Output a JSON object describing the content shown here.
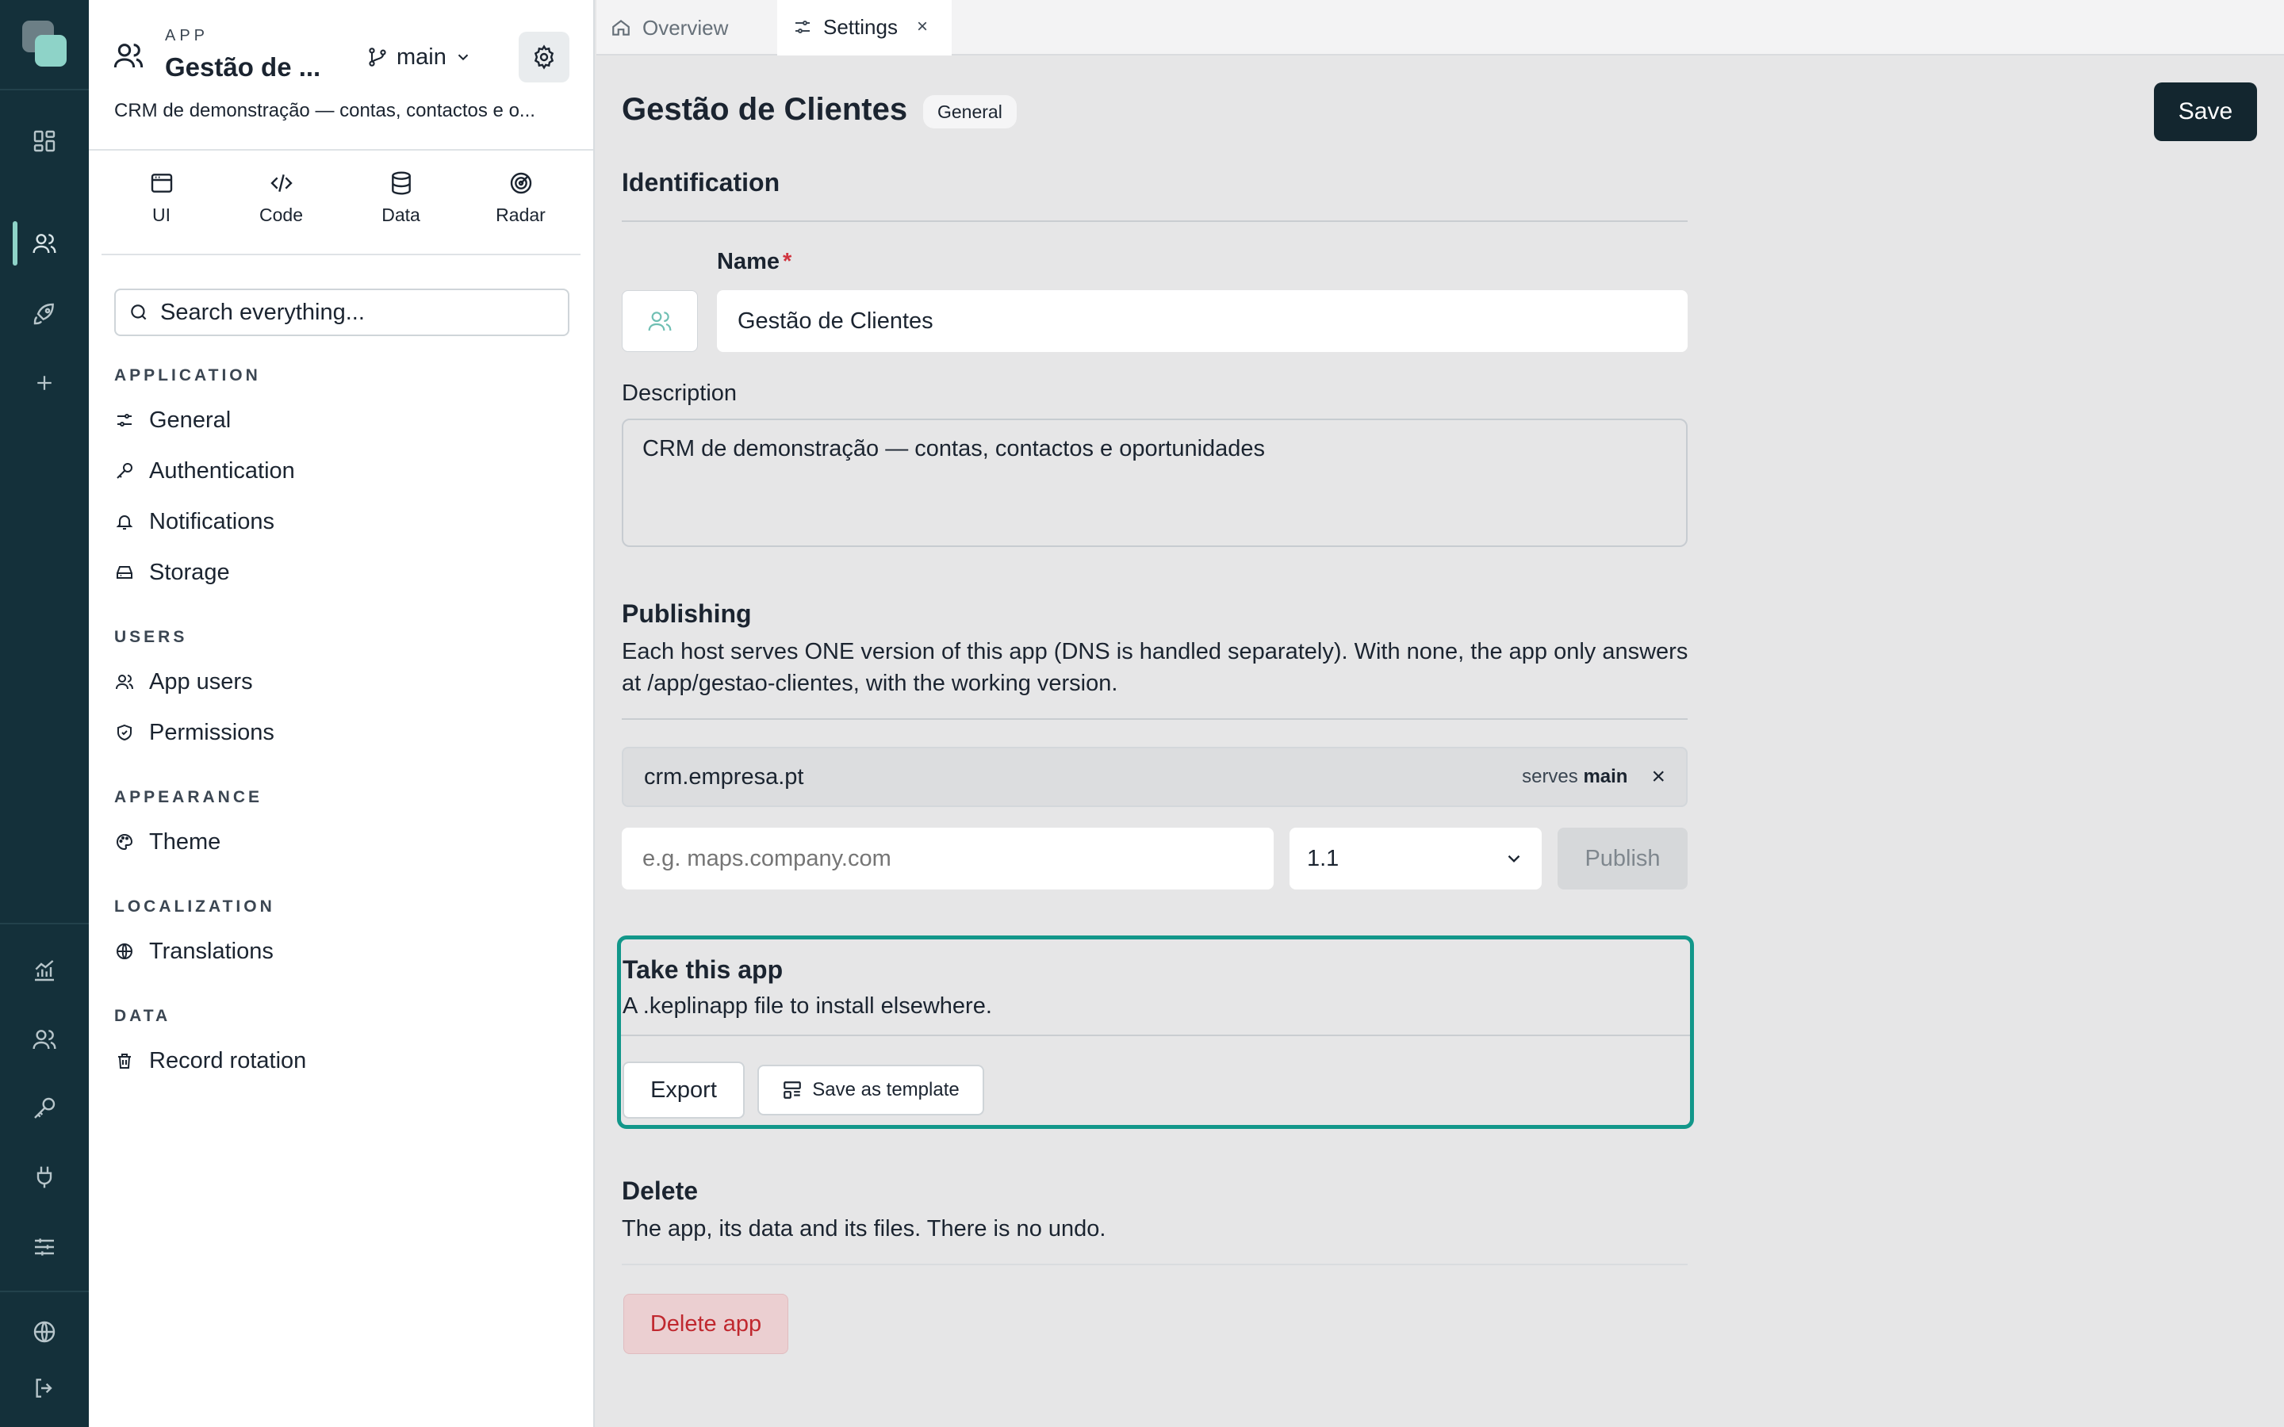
{
  "sidebar": {
    "app_kicker": "APP",
    "app_title": "Gestão de ...",
    "branch": "main",
    "app_description": "CRM de demonstração — contas, contactos e o...",
    "tools": [
      {
        "label": "UI",
        "icon": "window-icon"
      },
      {
        "label": "Code",
        "icon": "code-icon"
      },
      {
        "label": "Data",
        "icon": "database-icon"
      },
      {
        "label": "Radar",
        "icon": "radar-icon"
      }
    ],
    "search_placeholder": "Search everything...",
    "sections": {
      "application": "APPLICATION",
      "users": "USERS",
      "appearance": "APPEARANCE",
      "localization": "LOCALIZATION",
      "data": "DATA"
    },
    "items": {
      "general": "General",
      "authentication": "Authentication",
      "notifications": "Notifications",
      "storage": "Storage",
      "app_users": "App users",
      "permissions": "Permissions",
      "theme": "Theme",
      "translations": "Translations",
      "record_rotation": "Record rotation"
    }
  },
  "tabs": [
    {
      "label": "Overview",
      "icon": "home-icon"
    },
    {
      "label": "Settings",
      "icon": "sliders-icon",
      "close": "×"
    }
  ],
  "page": {
    "title": "Gestão de Clientes",
    "badge": "General",
    "save_label": "Save",
    "identification": {
      "heading": "Identification",
      "name_label": "Name",
      "required_mark": "*",
      "name_value": "Gestão de Clientes",
      "description_label": "Description",
      "description_value": "CRM de demonstração — contas, contactos e oportunidades"
    },
    "publishing": {
      "heading": "Publishing",
      "text": "Each host serves ONE version of this app (DNS is handled separately). With none, the app only answers at /app/gestao-clientes, with the working version.",
      "host": "crm.empresa.pt",
      "serves_prefix": "serves",
      "serves_branch": "main",
      "remove": "×",
      "host_placeholder": "e.g. maps.company.com",
      "version": "1.1",
      "publish_label": "Publish"
    },
    "take": {
      "heading": "Take this app",
      "text": "A .keplinapp file to install elsewhere.",
      "export_label": "Export",
      "template_label": "Save as template"
    },
    "delete": {
      "heading": "Delete",
      "text": "The app, its data and its files. There is no undo.",
      "button": "Delete app"
    }
  },
  "colors": {
    "rail": "#14303a",
    "accent": "#8ed3c8",
    "highlight_border": "#12978a",
    "primary_button": "#13262f",
    "danger_text": "#c0282f"
  }
}
